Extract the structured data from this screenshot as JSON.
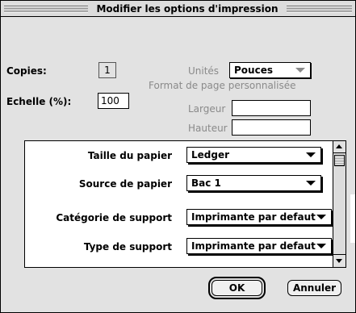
{
  "window": {
    "title": "Modifier les options d'impression"
  },
  "copies": {
    "label": "Copies:",
    "value": "1"
  },
  "echelle": {
    "label": "Echelle (%):",
    "value": "100"
  },
  "unites": {
    "label": "Unités",
    "selected": "Pouces"
  },
  "format": {
    "label": "Format de page personnalisée"
  },
  "largeur": {
    "label": "Largeur",
    "value": ""
  },
  "hauteur": {
    "label": "Hauteur",
    "value": ""
  },
  "list": {
    "rows": [
      {
        "label": "Taille du papier",
        "selected": "Ledger"
      },
      {
        "label": "Source de papier",
        "selected": "Bac 1"
      },
      {
        "label": "Catégorie de support",
        "selected": "Imprimante par defaut"
      },
      {
        "label": "Type de support",
        "selected": "Imprimante par defaut"
      }
    ]
  },
  "buttons": {
    "ok": "OK",
    "cancel": "Annuler"
  },
  "icons": [
    "scroll-up-arrow-icon",
    "scroll-down-arrow-icon",
    "popup-arrow-icon"
  ]
}
